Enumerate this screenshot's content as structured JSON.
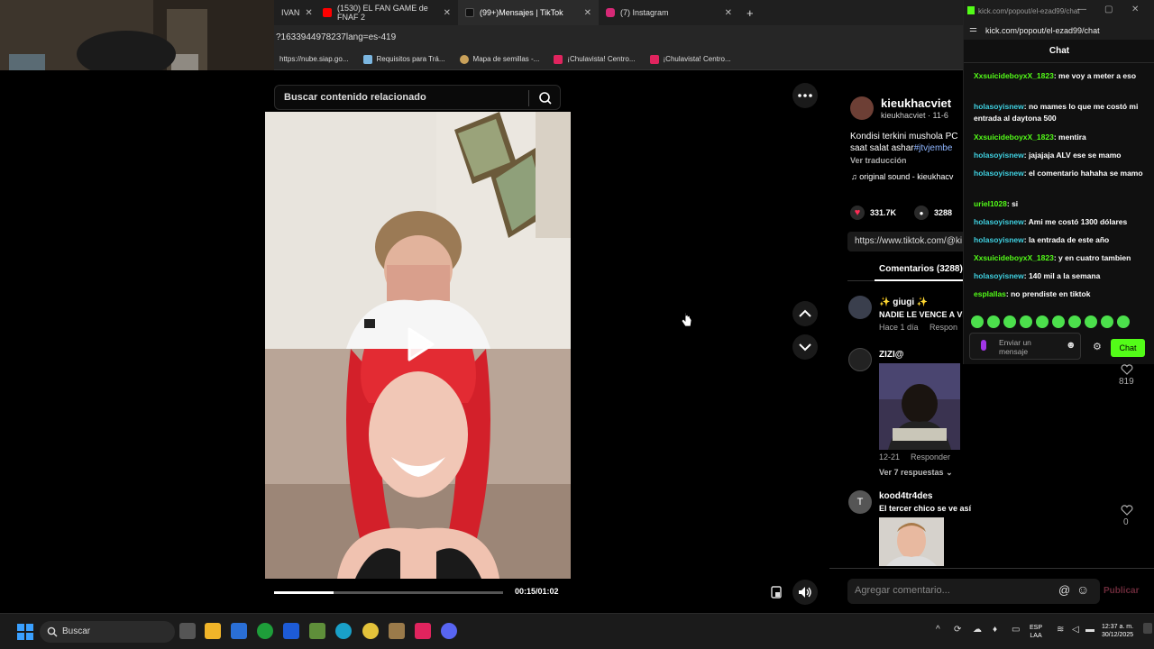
{
  "browser": {
    "tabs": [
      {
        "label": "IVAN",
        "active": false
      },
      {
        "label": "(1530) EL FAN GAME de FNAF 2",
        "active": false
      },
      {
        "label": "(99+)Mensajes | TikTok",
        "active": true
      },
      {
        "label": "(7) Instagram",
        "active": false
      }
    ],
    "new_tab": "+",
    "url": "?1633944978237lang=es-419",
    "bookmarks": [
      "https://nube.siap.go...",
      "Requisitos para Trá...",
      "Mapa de semillas -...",
      "¡Chulavista! Centro...",
      "¡Chulavista! Centro..."
    ]
  },
  "tiktok": {
    "search_placeholder": "Buscar contenido relacionado",
    "timecode": "00:15/01:02",
    "progress": 0.26,
    "author": {
      "name": "kieukhacviet",
      "sub": "kieukhacviet · 11-6"
    },
    "description_1": "Kondisi terkini mushola PC",
    "description_2": "saat salat ashar",
    "description_tag": "#jtvjembe",
    "translate": "Ver traducción",
    "sound": "original sound - kieukhacv",
    "likes": "331.7K",
    "comments_count": "3288",
    "link": "https://www.tiktok.com/@ki",
    "comments_tab": "Comentarios (3288)",
    "comments": [
      {
        "name": "✨ giugi ✨",
        "text": "NADIE LE VENCE A VL",
        "meta": "Hace 1 día",
        "reply": "Respon"
      },
      {
        "name": "ZIZI@",
        "date": "12-21",
        "reply": "Responder",
        "more": "Ver 7 respuestas",
        "likes": "819"
      },
      {
        "name": "kood4tr4des",
        "text": "El tercer chico se ve así",
        "likes": "0",
        "avatar_letter": "T"
      }
    ],
    "add_comment_placeholder": "Agregar comentario...",
    "publish": "Publicar"
  },
  "kick": {
    "title_url": "kick.com/popout/el-ezad99/chat",
    "address": "kick.com/popout/el-ezad99/chat",
    "header": "Chat",
    "messages": [
      {
        "user": "XxsuicideboyxX_1823",
        "text": "me voy a meter a eso",
        "color": "#53fc18"
      },
      {
        "user": "holasoyisnew",
        "text": "no mames lo que me costó mi entrada al daytona 500",
        "color": "#3fd0e0"
      },
      {
        "user": "XxsuicideboyxX_1823",
        "text": "mentira",
        "color": "#53fc18"
      },
      {
        "user": "holasoyisnew",
        "text": "jajajaja ALV ese se mamo",
        "color": "#3fd0e0"
      },
      {
        "user": "holasoyisnew",
        "text": "el comentario hahaha se mamo",
        "color": "#3fd0e0"
      },
      {
        "user": "uriel1028",
        "text": "si",
        "color": "#53fc18"
      },
      {
        "user": "holasoyisnew",
        "text": "Ami me costó 1300 dólares",
        "color": "#3fd0e0"
      },
      {
        "user": "holasoyisnew",
        "text": "la entrada de este año",
        "color": "#3fd0e0"
      },
      {
        "user": "XxsuicideboyxX_1823",
        "text": "y en cuatro tambien",
        "color": "#53fc18"
      },
      {
        "user": "holasoyisnew",
        "text": "140 mil a la semana",
        "color": "#3fd0e0"
      },
      {
        "user": "esplallas",
        "text": "no prendiste en tiktok",
        "color": "#53fc18"
      }
    ],
    "input_placeholder": "Enviar un mensaje",
    "send_label": "Chat"
  },
  "taskbar": {
    "search": "Buscar",
    "lang_1": "ESP",
    "lang_2": "LAA",
    "time": "12:37 a. m.",
    "date": "30/12/2025"
  }
}
